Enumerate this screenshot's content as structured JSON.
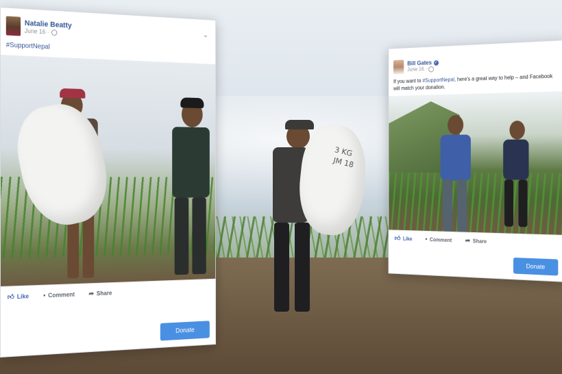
{
  "posts": [
    {
      "author": "Natalie Beatty",
      "date": "June 16 ·",
      "text": "#SupportNepal",
      "actions": {
        "like": "Like",
        "comment": "Comment",
        "share": "Share"
      },
      "donate_label": "Donate",
      "menu_icon": "chevron-down-icon"
    },
    {
      "author": "Bill Gates",
      "date": "June 16 ·",
      "text_before": "If you want to ",
      "hashtag": "#SupportNepal",
      "text_after": ", here's a great way to help – and Facebook will match your donation.",
      "actions": {
        "like": "Like",
        "comment": "Comment",
        "share": "Share"
      },
      "donate_label": "Donate"
    }
  ],
  "colors": {
    "link_blue": "#365899",
    "donate_blue": "#4a90e2",
    "like_blue": "#4267b2"
  },
  "background_scene": {
    "sack_labels": [
      "3 KG",
      "JM 18"
    ]
  }
}
